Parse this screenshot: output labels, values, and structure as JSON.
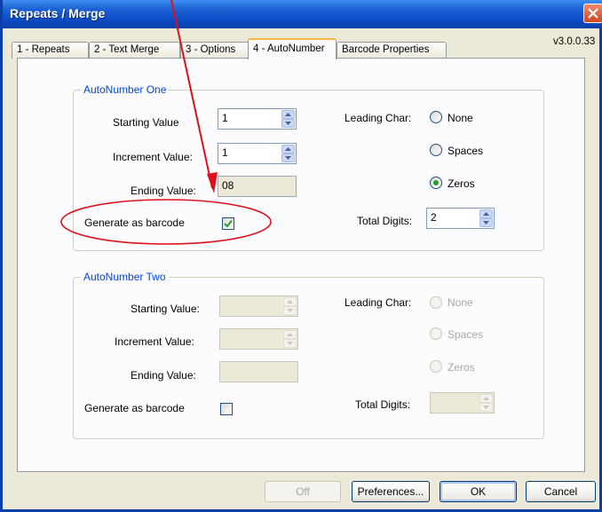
{
  "window": {
    "title": "Repeats / Merge",
    "version": "v3.0.0.33"
  },
  "tabs": [
    {
      "label": "1 - Repeats"
    },
    {
      "label": "2 - Text Merge"
    },
    {
      "label": "3 - Options"
    },
    {
      "label": "4 - AutoNumber",
      "active": true
    },
    {
      "label": "Barcode Properties"
    }
  ],
  "group_one": {
    "title": "AutoNumber One",
    "starting_label": "Starting Value",
    "starting_value": "1",
    "increment_label": "Increment Value:",
    "increment_value": "1",
    "ending_label": "Ending Value:",
    "ending_value": "08",
    "generate_label": "Generate as barcode",
    "generate_checked": true,
    "leading_label": "Leading Char:",
    "leading_options": [
      "None",
      "Spaces",
      "Zeros"
    ],
    "leading_selected": "Zeros",
    "total_label": "Total Digits:",
    "total_value": "2"
  },
  "group_two": {
    "title": "AutoNumber Two",
    "starting_label": "Starting Value:",
    "starting_value": "",
    "increment_label": "Increment Value:",
    "increment_value": "",
    "ending_label": "Ending Value:",
    "ending_value": "",
    "generate_label": "Generate as barcode",
    "generate_checked": false,
    "leading_label": "Leading Char:",
    "leading_options": [
      "None",
      "Spaces",
      "Zeros"
    ],
    "leading_selected": null,
    "total_label": "Total Digits:",
    "total_value": ""
  },
  "buttons": {
    "off": "Off",
    "preferences": "Preferences...",
    "ok": "OK",
    "cancel": "Cancel"
  },
  "colors": {
    "title_bar": "#0a3fa8",
    "dialog_bg": "#ece9d8",
    "group_title": "#0046d5",
    "annotation": "#e0101a",
    "selected_radio": "#21a121"
  },
  "icons": [
    "close-icon",
    "spin-up-icon",
    "spin-down-icon",
    "checkmark-icon",
    "annotation-arrow",
    "annotation-ellipse"
  ]
}
